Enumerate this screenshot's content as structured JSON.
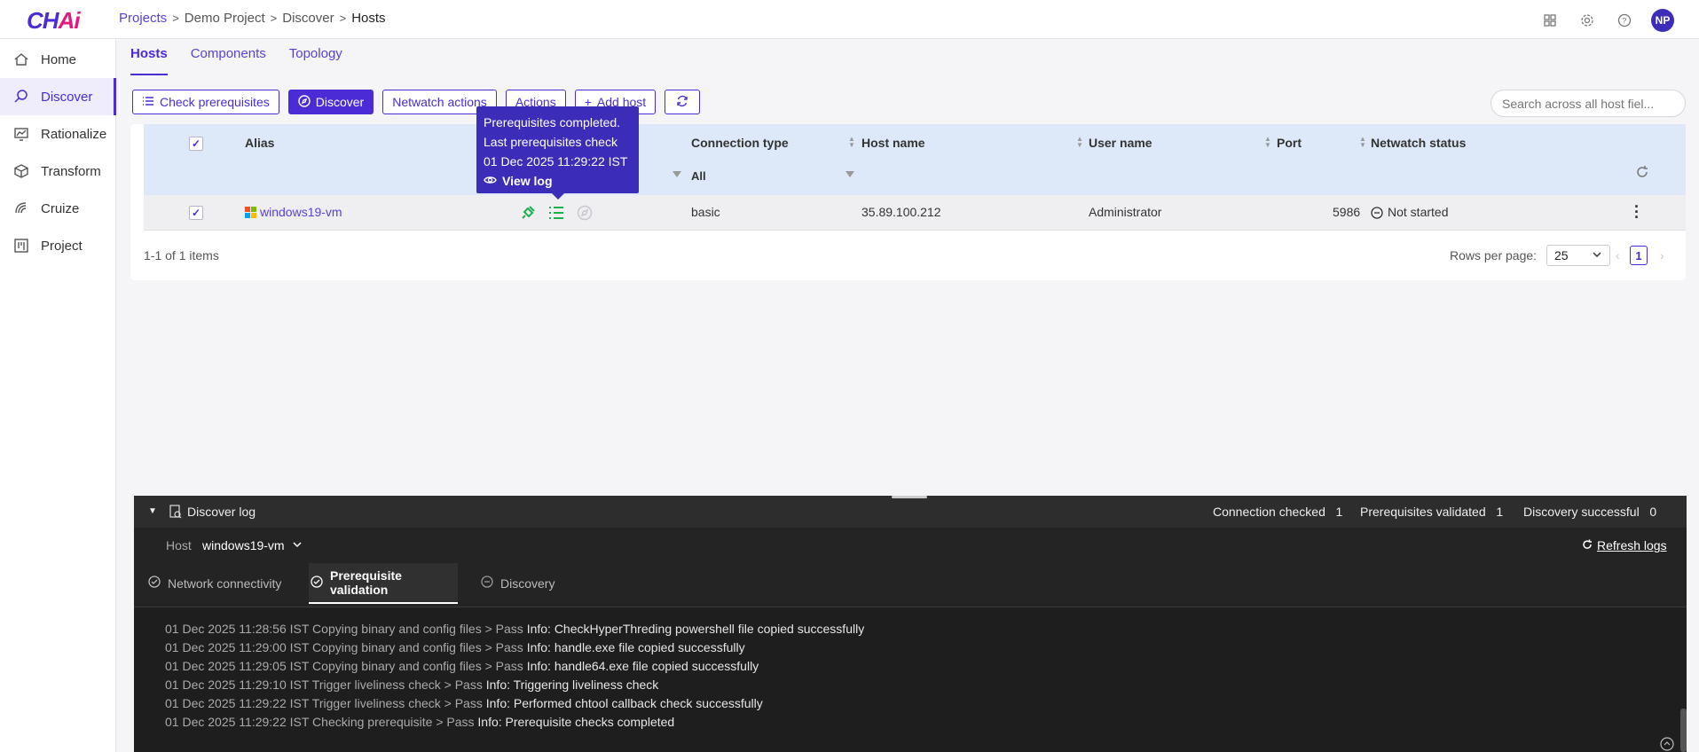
{
  "app": {
    "logo_text": "CH",
    "logo_ai": "Ai"
  },
  "breadcrumb": [
    "Projects",
    "Demo Project",
    "Discover",
    "Hosts"
  ],
  "user": {
    "initials": "NP"
  },
  "sidebar": {
    "items": [
      {
        "label": "Home",
        "icon": "home-icon"
      },
      {
        "label": "Discover",
        "icon": "discover-icon",
        "active": true
      },
      {
        "label": "Rationalize",
        "icon": "rationalize-icon"
      },
      {
        "label": "Transform",
        "icon": "cube-icon"
      },
      {
        "label": "Cruize",
        "icon": "cruize-icon"
      },
      {
        "label": "Project",
        "icon": "kanban-icon"
      }
    ]
  },
  "tabs": [
    "Hosts",
    "Components",
    "Topology"
  ],
  "toolbar": {
    "check_prereq": "Check prerequisites",
    "discover": "Discover",
    "netwatch": "Netwatch actions",
    "actions": "Actions",
    "add_host": "Add host"
  },
  "search": {
    "placeholder": "Search across all host fiel..."
  },
  "table": {
    "columns": {
      "alias": "Alias",
      "connection_type": "Connection type",
      "host_name": "Host name",
      "user_name": "User name",
      "port": "Port",
      "netwatch_status": "Netwatch status"
    },
    "filter_all_1": "All",
    "rows": [
      {
        "alias": "windows19-vm",
        "connection_type": "basic",
        "host_name": "35.89.100.212",
        "user_name": "Administrator",
        "port": "5986",
        "netwatch_status": "Not started"
      }
    ],
    "items_text": "1-1 of 1 items",
    "rows_per_page_label": "Rows per page:",
    "rows_per_page": "25",
    "page": "1"
  },
  "tooltip": {
    "line1": "Prerequisites completed.",
    "line2": "Last prerequisites check",
    "line3": "01 Dec 2025 11:29:22 IST",
    "link": "View log"
  },
  "log": {
    "title": "Discover log",
    "stats": [
      {
        "label": "Connection checked",
        "value": "1"
      },
      {
        "label": "Prerequisites validated",
        "value": "1"
      },
      {
        "label": "Discovery successful",
        "value": "0"
      }
    ],
    "host_label": "Host",
    "host_value": "windows19-vm",
    "refresh": "Refresh logs",
    "tabs": [
      "Network connectivity",
      "Prerequisite validation",
      "Discovery"
    ],
    "lines": [
      {
        "prefix": "01 Dec 2025 11:28:56 IST Copying binary and config files > Pass",
        "msg": "Info: CheckHyperThreding powershell file copied successfully"
      },
      {
        "prefix": "01 Dec 2025 11:29:00 IST Copying binary and config files > Pass",
        "msg": "Info: handle.exe file copied successfully"
      },
      {
        "prefix": "01 Dec 2025 11:29:05 IST Copying binary and config files > Pass",
        "msg": "Info: handle64.exe file copied successfully"
      },
      {
        "prefix": "01 Dec 2025 11:29:10 IST Trigger liveliness check > Pass",
        "msg": "Info: Triggering liveliness check"
      },
      {
        "prefix": "01 Dec 2025 11:29:22 IST Trigger liveliness check > Pass",
        "msg": "Info: Performed chtool callback check successfully"
      },
      {
        "prefix": "01 Dec 2025 11:29:22 IST Checking prerequisite > Pass",
        "msg": "Info: Prerequisite checks completed"
      }
    ]
  },
  "colors": {
    "accent": "#4a2bd6",
    "brand_pink": "#e6187c",
    "success": "#1fae4b"
  }
}
